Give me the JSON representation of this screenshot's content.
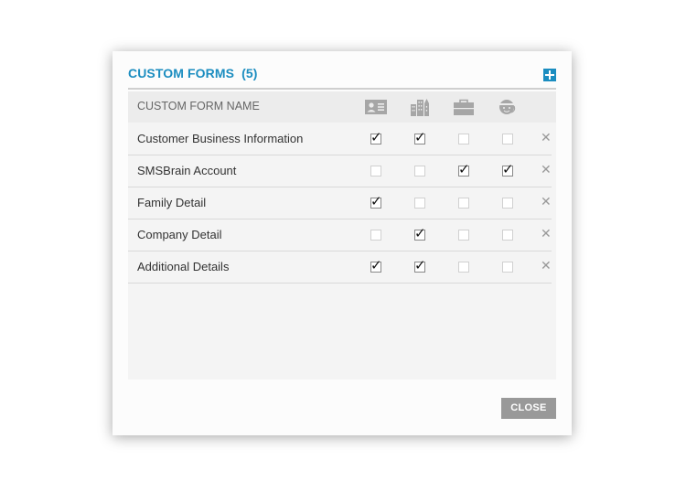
{
  "dialog": {
    "title": "CUSTOM FORMS",
    "count": "(5)",
    "add_icon": "plus-icon",
    "close_label": "CLOSE"
  },
  "table": {
    "name_header": "CUSTOM FORM NAME",
    "column_icons": [
      "contact-card-icon",
      "buildings-icon",
      "briefcase-icon",
      "headset-agent-icon"
    ],
    "rows": [
      {
        "name": "Customer Business Information",
        "checks": [
          true,
          true,
          false,
          false
        ]
      },
      {
        "name": "SMSBrain Account",
        "checks": [
          false,
          false,
          true,
          true
        ]
      },
      {
        "name": "Family Detail",
        "checks": [
          true,
          false,
          false,
          false
        ]
      },
      {
        "name": "Company Detail",
        "checks": [
          false,
          true,
          false,
          false
        ]
      },
      {
        "name": "Additional Details",
        "checks": [
          true,
          true,
          false,
          false
        ]
      }
    ],
    "delete_icon": "close-icon"
  },
  "colors": {
    "accent": "#1b8dc0",
    "icon_gray": "#a6a6a6",
    "close_button": "#999999"
  }
}
